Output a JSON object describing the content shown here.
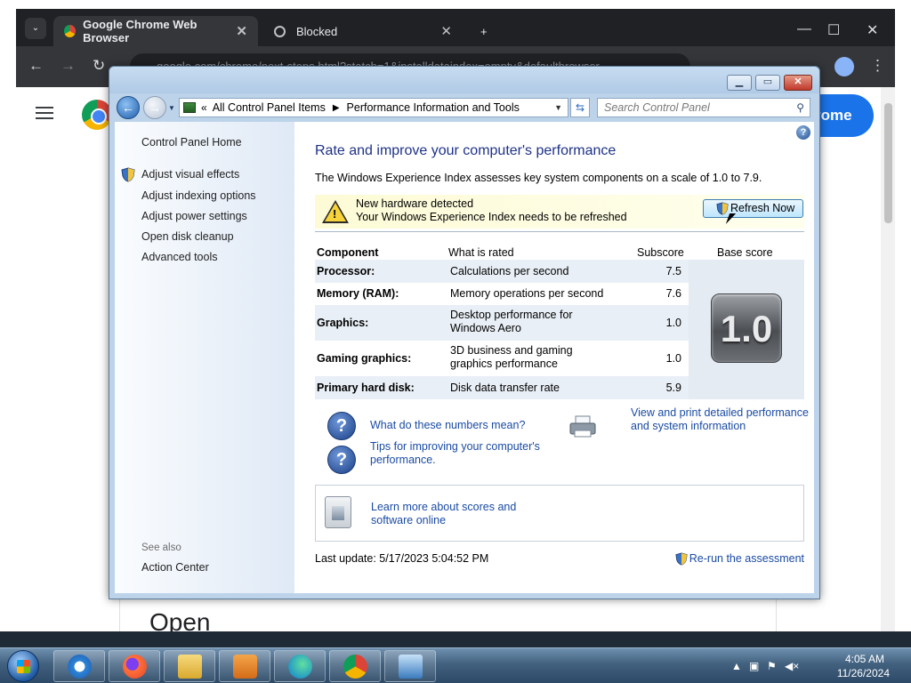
{
  "chrome": {
    "tabs": [
      {
        "title": "Google Chrome Web Browser",
        "active": true
      },
      {
        "title": "Blocked",
        "active": false
      }
    ],
    "address": "google.com/chrome/next-steps.html?statcb=1&installdataindex=empty&defaultbrowser",
    "page": {
      "cta_text": "rome",
      "heading_partial": "Open"
    }
  },
  "window": {
    "breadcrumb": [
      "All Control Panel Items",
      "Performance Information and Tools"
    ],
    "search_placeholder": "Search Control Panel",
    "caption_buttons": {
      "minimize": "▁",
      "maximize": "▭",
      "close": "✕"
    }
  },
  "sidebar": {
    "home": "Control Panel Home",
    "links": [
      {
        "label": "Adjust visual effects",
        "shield": true
      },
      {
        "label": "Adjust indexing options",
        "shield": false
      },
      {
        "label": "Adjust power settings",
        "shield": false
      },
      {
        "label": "Open disk cleanup",
        "shield": false
      },
      {
        "label": "Advanced tools",
        "shield": false
      }
    ],
    "see_also_label": "See also",
    "see_also_links": [
      "Action Center"
    ]
  },
  "main": {
    "title": "Rate and improve your computer's performance",
    "description": "The Windows Experience Index assesses key system components on a scale of 1.0 to 7.9.",
    "notice": {
      "line1": "New hardware detected",
      "line2": "Your Windows Experience Index needs to be refreshed",
      "button": "Refresh Now"
    },
    "table": {
      "headers": {
        "component": "Component",
        "rated": "What is rated",
        "subscore": "Subscore",
        "base": "Base score"
      },
      "rows": [
        {
          "component": "Processor:",
          "rated": "Calculations per second",
          "subscore": "7.5"
        },
        {
          "component": "Memory (RAM):",
          "rated": "Memory operations per second",
          "subscore": "7.6"
        },
        {
          "component": "Graphics:",
          "rated": "Desktop performance for Windows Aero",
          "subscore": "1.0"
        },
        {
          "component": "Gaming graphics:",
          "rated": "3D business and gaming graphics performance",
          "subscore": "1.0"
        },
        {
          "component": "Primary hard disk:",
          "rated": "Disk data transfer rate",
          "subscore": "5.9"
        }
      ],
      "base_score": "1.0"
    },
    "links": {
      "numbers_meaning": "What do these numbers mean?",
      "tips": "Tips for improving your computer's performance.",
      "print": "View and print detailed performance and system information",
      "learn_more": "Learn more about scores and software online"
    },
    "last_update": "Last update: 5/17/2023 5:04:52 PM",
    "rerun": "Re-run the assessment"
  },
  "taskbar": {
    "apps": [
      "Internet Explorer",
      "Firefox",
      "Windows Explorer",
      "Media Player",
      "Edge",
      "Chrome",
      "Control Panel"
    ],
    "time": "4:05 AM",
    "date": "11/26/2024"
  },
  "colors": {
    "title_blue": "#1e3287",
    "link_blue": "#1a4ba3",
    "notice_yellow": "#fdfbd6"
  }
}
